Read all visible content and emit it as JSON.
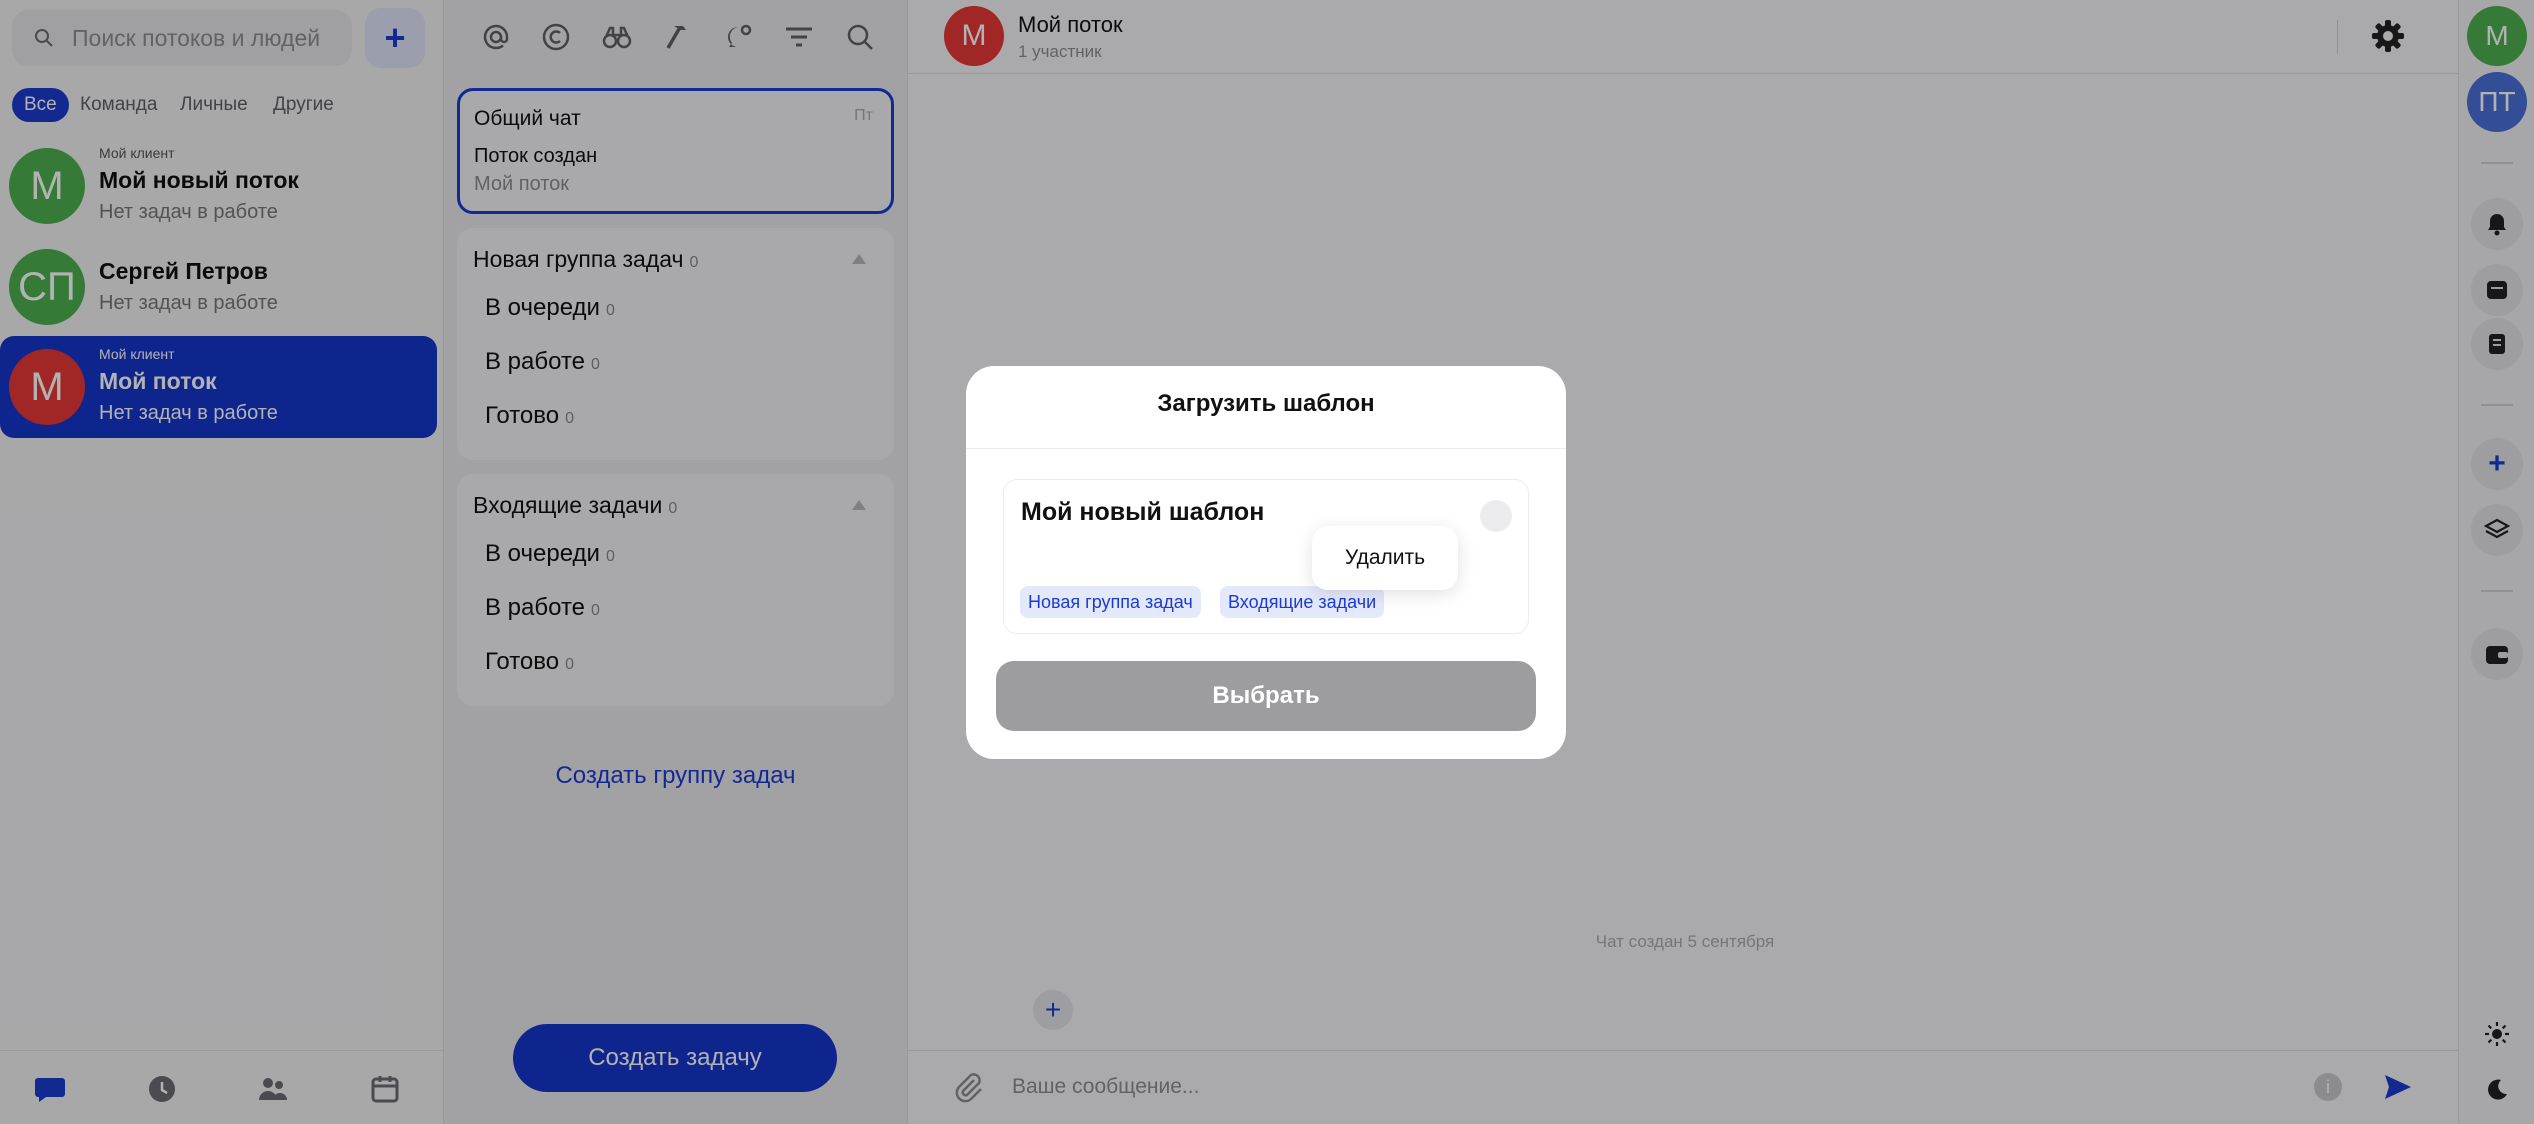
{
  "sidebar": {
    "search_placeholder": "Поиск потоков и людей",
    "add_label": "+",
    "filters": [
      "Все",
      "Команда",
      "Личные",
      "Другие"
    ],
    "chats": [
      {
        "client": "Мой клиент",
        "name": "Мой новый поток",
        "sub": "Нет задач в работе",
        "initials": "М",
        "color": "#4caf50"
      },
      {
        "client": "",
        "name": "Сергей Петров",
        "sub": "Нет задач в работе",
        "initials": "СП",
        "color": "#4caf50"
      },
      {
        "client": "Мой клиент",
        "name": "Мой поток",
        "sub": "Нет задач в работе",
        "initials": "М",
        "color": "#e53935"
      }
    ]
  },
  "task_panel": {
    "general_chat": {
      "title": "Общий чат",
      "day": "Пт",
      "last_message": "Поток создан",
      "stream": "Мой поток"
    },
    "groups": [
      {
        "title": "Новая группа задач",
        "count": "0",
        "rows": [
          {
            "label": "В очереди",
            "count": "0"
          },
          {
            "label": "В работе",
            "count": "0"
          },
          {
            "label": "Готово",
            "count": "0"
          }
        ]
      },
      {
        "title": "Входящие задачи",
        "count": "0",
        "rows": [
          {
            "label": "В очереди",
            "count": "0"
          },
          {
            "label": "В работе",
            "count": "0"
          },
          {
            "label": "Готово",
            "count": "0"
          }
        ]
      }
    ],
    "create_group_label": "Создать группу задач",
    "create_task_label": "Создать задачу"
  },
  "chat": {
    "title": "Мой поток",
    "subtitle": "1 участник",
    "avatar_initials": "М",
    "created_note": "Чат создан 5 сентября",
    "message_placeholder": "Ваше сообщение..."
  },
  "rail": {
    "avatars": [
      {
        "initials": "М",
        "color": "#4caf50"
      },
      {
        "initials": "ПТ",
        "color": "#4a6fd8"
      }
    ]
  },
  "modal": {
    "title": "Загрузить шаблон",
    "template_name": "Мой новый шаблон",
    "tags": [
      "Новая группа задач",
      "Входящие задачи"
    ],
    "delete_label": "Удалить",
    "select_label": "Выбрать"
  },
  "colors": {
    "accent": "#1636cc",
    "danger_avatar": "#e53935",
    "green_avatar": "#4caf50"
  },
  "icons": [
    "search-icon",
    "plus-icon",
    "at-icon",
    "copyright-icon",
    "binoculars-icon",
    "hammer-icon",
    "chat-bubble-icon",
    "filter-icon",
    "gear-icon",
    "paperclip-icon",
    "info-icon",
    "send-icon",
    "bell-icon",
    "sun-icon",
    "moon-icon"
  ]
}
